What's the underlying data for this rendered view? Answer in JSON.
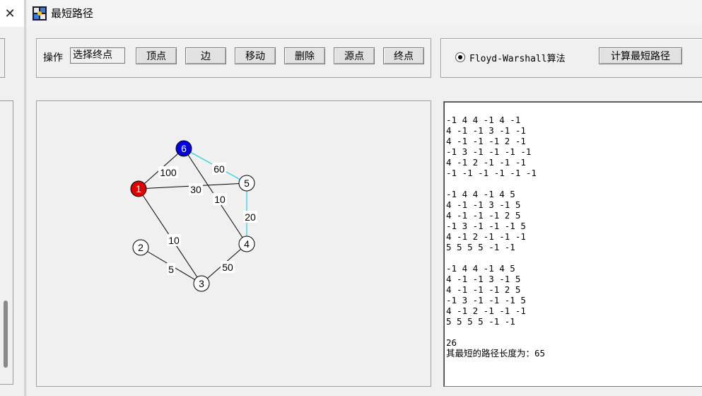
{
  "background_window": {
    "close_glyph": "✕"
  },
  "window": {
    "title": "最短路径"
  },
  "toolbar": {
    "op_label": "操作",
    "mode_value": "选择终点",
    "buttons": [
      "顶点",
      "边",
      "移动",
      "删除",
      "源点",
      "终点"
    ]
  },
  "algorithm": {
    "option_label": "Floyd-Warshall算法",
    "selected": true,
    "compute_label": "计算最短路径"
  },
  "graph": {
    "vertices": [
      {
        "id": "1",
        "label": "1",
        "role": "source",
        "color": "#e00000"
      },
      {
        "id": "2",
        "label": "2",
        "role": "normal",
        "color": "#ffffff"
      },
      {
        "id": "3",
        "label": "3",
        "role": "normal",
        "color": "#ffffff"
      },
      {
        "id": "4",
        "label": "4",
        "role": "normal",
        "color": "#ffffff"
      },
      {
        "id": "5",
        "label": "5",
        "role": "normal",
        "color": "#ffffff"
      },
      {
        "id": "6",
        "label": "6",
        "role": "target",
        "color": "#0000e0"
      }
    ],
    "edges": [
      {
        "from": "1",
        "to": "6",
        "weight": "100",
        "highlight": false
      },
      {
        "from": "1",
        "to": "5",
        "weight": "30",
        "highlight": false
      },
      {
        "from": "1",
        "to": "3",
        "weight": "10",
        "highlight": false
      },
      {
        "from": "6",
        "to": "5",
        "weight": "60",
        "highlight": true
      },
      {
        "from": "6",
        "to": "4",
        "weight": "10",
        "highlight": false
      },
      {
        "from": "5",
        "to": "4",
        "weight": "20",
        "highlight": true
      },
      {
        "from": "2",
        "to": "3",
        "weight": "5",
        "highlight": false
      },
      {
        "from": "3",
        "to": "4",
        "weight": "50",
        "highlight": false
      }
    ],
    "edge_color": "#000000",
    "highlight_color": "#00c8e0"
  },
  "output": {
    "lines": [
      "-1 4 4 -1 4 -1",
      "4 -1 -1 3 -1 -1",
      "4 -1 -1 -1 2 -1",
      "-1 3 -1 -1 -1 -1",
      "4 -1 2 -1 -1 -1",
      "-1 -1 -1 -1 -1 -1",
      "",
      "-1 4 4 -1 4 5",
      "4 -1 -1 3 -1 5",
      "4 -1 -1 -1 2 5",
      "-1 3 -1 -1 -1 5",
      "4 -1 2 -1 -1 -1",
      "5 5 5 5 -1 -1",
      "",
      "-1 4 4 -1 4 5",
      "4 -1 -1 3 -1 5",
      "4 -1 -1 -1 2 5",
      "-1 3 -1 -1 -1 5",
      "4 -1 2 -1 -1 -1",
      "5 5 5 5 -1 -1"
    ],
    "summary_value": "26",
    "summary_text": "其最短的路径长度为：65"
  }
}
